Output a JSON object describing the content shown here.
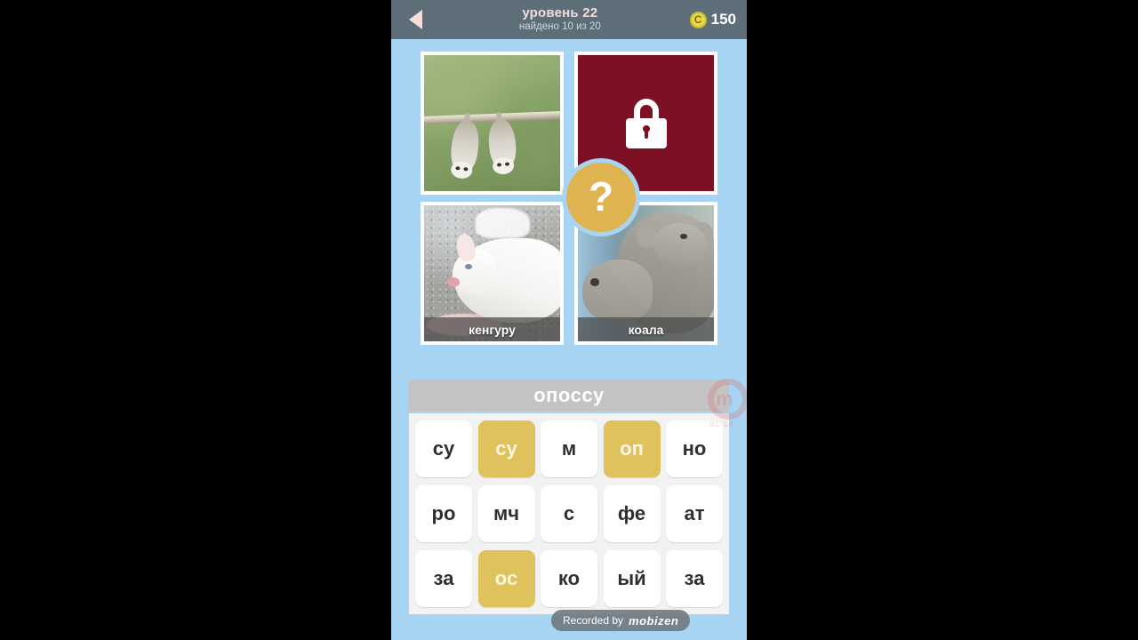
{
  "header": {
    "back_icon": "back-arrow-icon",
    "level_title": "уровень 22",
    "progress_text": "найдено 10 из 20",
    "coin_icon": "coin-icon",
    "coin_glyph": "C",
    "coin_count": "150"
  },
  "grid": {
    "cells": [
      {
        "name": "opossum-photo",
        "state": "revealed",
        "caption": "",
        "alt": "two opossums hanging from a branch"
      },
      {
        "name": "locked-photo",
        "state": "locked",
        "caption": "",
        "icon": "lock-icon"
      },
      {
        "name": "kangaroo-photo",
        "state": "solved",
        "caption": "кенгуру",
        "alt": "white albino kangaroo on gravel"
      },
      {
        "name": "koala-photo",
        "state": "solved",
        "caption": "коала",
        "alt": "two koalas on a branch"
      }
    ]
  },
  "hint": {
    "icon": "question-mark-icon",
    "label": "?"
  },
  "answer": {
    "current": "опоссу"
  },
  "keyboard": {
    "rows": [
      [
        {
          "label": "су",
          "state": "normal"
        },
        {
          "label": "су",
          "state": "used"
        },
        {
          "label": "м",
          "state": "normal"
        },
        {
          "label": "оп",
          "state": "used"
        },
        {
          "label": "но",
          "state": "normal"
        }
      ],
      [
        {
          "label": "ро",
          "state": "normal"
        },
        {
          "label": "мч",
          "state": "normal"
        },
        {
          "label": "с",
          "state": "normal"
        },
        {
          "label": "фе",
          "state": "normal"
        },
        {
          "label": "ат",
          "state": "normal"
        }
      ],
      [
        {
          "label": "за",
          "state": "normal"
        },
        {
          "label": "ос",
          "state": "used"
        },
        {
          "label": "ко",
          "state": "normal"
        },
        {
          "label": "ый",
          "state": "normal"
        },
        {
          "label": "за",
          "state": "normal"
        }
      ]
    ]
  },
  "watermarks": {
    "recorded_label": "Recorded by",
    "recorded_brand": "mobizen",
    "side_logo_letter": "m",
    "side_logo_sub": "01:14"
  },
  "colors": {
    "header_bg": "#5d6e78",
    "page_bg": "#a6d4f2",
    "locked_tile": "#7d1022",
    "accent_gold": "#e0c25c",
    "hint_gold": "#e0b351",
    "answer_bar": "#c3c3c3",
    "keyboard_bg": "#f2f2f2"
  }
}
